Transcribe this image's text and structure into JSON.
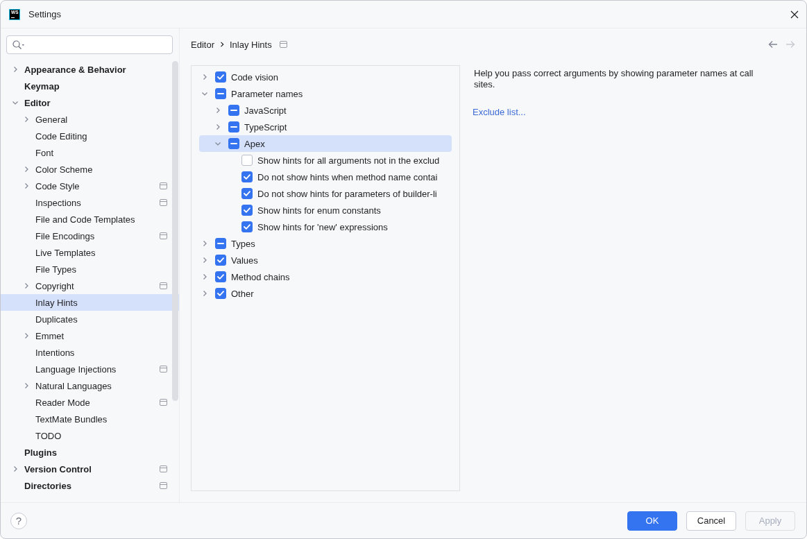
{
  "window": {
    "title": "Settings",
    "logo_text": "WS"
  },
  "sidebar": {
    "items": [
      {
        "label": "Appearance & Behavior",
        "expanded": false,
        "selected": false,
        "project_level": false
      },
      {
        "label": "Keymap",
        "selected": false,
        "project_level": false
      },
      {
        "label": "Editor",
        "expanded": true,
        "selected": false,
        "project_level": false,
        "children": [
          {
            "label": "General",
            "expanded": false,
            "selected": false,
            "project_level": false
          },
          {
            "label": "Code Editing",
            "selected": false,
            "project_level": false
          },
          {
            "label": "Font",
            "selected": false,
            "project_level": false
          },
          {
            "label": "Color Scheme",
            "expanded": false,
            "selected": false,
            "project_level": false
          },
          {
            "label": "Code Style",
            "expanded": false,
            "selected": false,
            "project_level": true
          },
          {
            "label": "Inspections",
            "selected": false,
            "project_level": true
          },
          {
            "label": "File and Code Templates",
            "selected": false,
            "project_level": false
          },
          {
            "label": "File Encodings",
            "selected": false,
            "project_level": true
          },
          {
            "label": "Live Templates",
            "selected": false,
            "project_level": false
          },
          {
            "label": "File Types",
            "selected": false,
            "project_level": false
          },
          {
            "label": "Copyright",
            "expanded": false,
            "selected": false,
            "project_level": true
          },
          {
            "label": "Inlay Hints",
            "selected": true,
            "project_level": false
          },
          {
            "label": "Duplicates",
            "selected": false,
            "project_level": false
          },
          {
            "label": "Emmet",
            "expanded": false,
            "selected": false,
            "project_level": false
          },
          {
            "label": "Intentions",
            "selected": false,
            "project_level": false
          },
          {
            "label": "Language Injections",
            "selected": false,
            "project_level": true
          },
          {
            "label": "Natural Languages",
            "expanded": false,
            "selected": false,
            "project_level": false
          },
          {
            "label": "Reader Mode",
            "selected": false,
            "project_level": true
          },
          {
            "label": "TextMate Bundles",
            "selected": false,
            "project_level": false
          },
          {
            "label": "TODO",
            "selected": false,
            "project_level": false
          }
        ]
      },
      {
        "label": "Plugins",
        "selected": false,
        "project_level": false
      },
      {
        "label": "Version Control",
        "expanded": false,
        "selected": false,
        "project_level": true
      },
      {
        "label": "Directories",
        "selected": false,
        "project_level": true
      }
    ]
  },
  "breadcrumb": {
    "items": [
      "Editor",
      "Inlay Hints"
    ],
    "project_level": true
  },
  "navigation": [
    {
      "kind": "back",
      "disabled": false
    },
    {
      "kind": "forward",
      "disabled": true
    }
  ],
  "hint_tree": [
    {
      "label": "Code vision",
      "expanded": false,
      "checked": true,
      "mixed": false,
      "selected": false
    },
    {
      "label": "Parameter names",
      "expanded": true,
      "checked": true,
      "mixed": true,
      "selected": false,
      "children": [
        {
          "label": "JavaScript",
          "expanded": false,
          "checked": true,
          "mixed": true,
          "selected": false
        },
        {
          "label": "TypeScript",
          "expanded": false,
          "checked": true,
          "mixed": true,
          "selected": false
        },
        {
          "label": "Apex",
          "expanded": true,
          "checked": true,
          "mixed": true,
          "selected": true,
          "children": [
            {
              "label": "Show hints for all arguments not in the exclud",
              "checked": false,
              "mixed": false,
              "selected": false
            },
            {
              "label": "Do not show hints when method name contai",
              "checked": true,
              "mixed": false,
              "selected": false
            },
            {
              "label": "Do not show hints for parameters of builder-li",
              "checked": true,
              "mixed": false,
              "selected": false
            },
            {
              "label": "Show hints for enum constants",
              "checked": true,
              "mixed": false,
              "selected": false
            },
            {
              "label": "Show hints for 'new' expressions",
              "checked": true,
              "mixed": false,
              "selected": false
            }
          ]
        }
      ]
    },
    {
      "label": "Types",
      "expanded": false,
      "checked": true,
      "mixed": true,
      "selected": false
    },
    {
      "label": "Values",
      "expanded": false,
      "checked": true,
      "mixed": false,
      "selected": false
    },
    {
      "label": "Method chains",
      "expanded": false,
      "checked": true,
      "mixed": false,
      "selected": false
    },
    {
      "label": "Other",
      "expanded": false,
      "checked": true,
      "mixed": false,
      "selected": false
    }
  ],
  "description": {
    "text": "Help you pass correct arguments by showing parameter names at call sites.",
    "link": "Exclude list..."
  },
  "footer": {
    "help_label": "?",
    "buttons": [
      {
        "label": "OK",
        "kind": "primary",
        "disabled": false
      },
      {
        "label": "Cancel",
        "kind": "secondary",
        "disabled": false
      },
      {
        "label": "Apply",
        "kind": "secondary",
        "disabled": true
      }
    ]
  }
}
